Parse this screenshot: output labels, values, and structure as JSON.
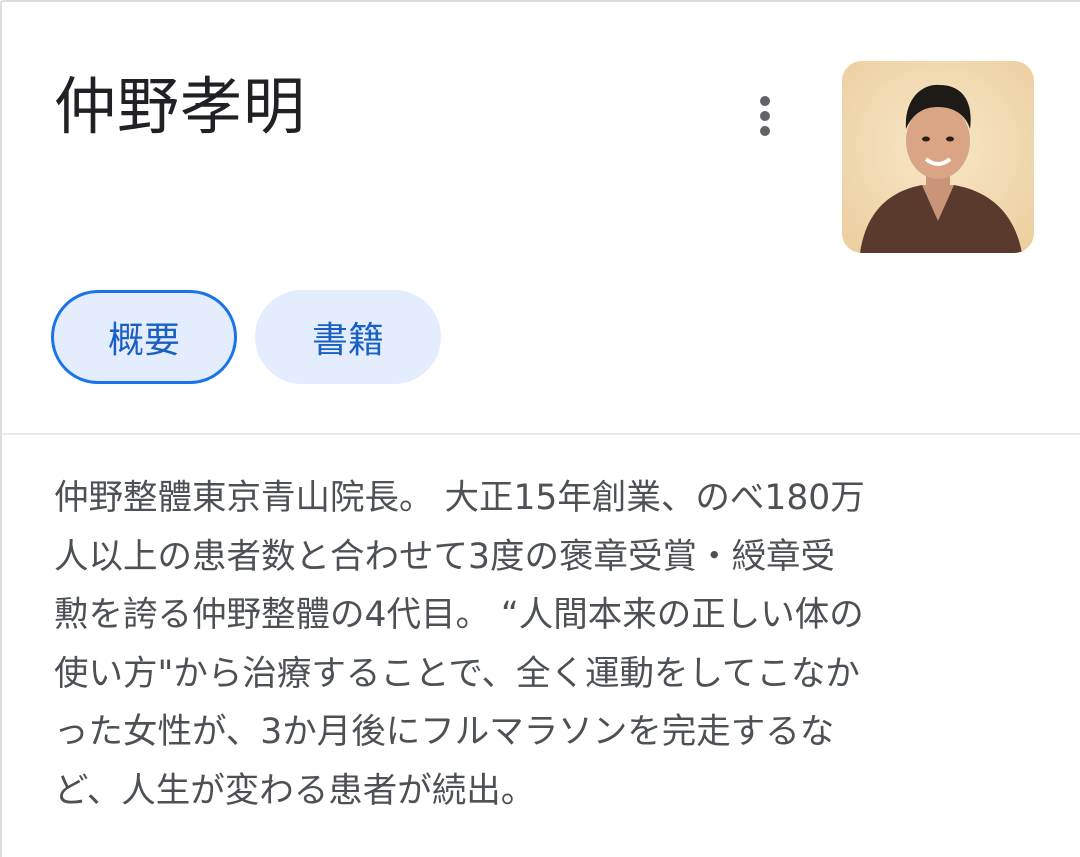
{
  "header": {
    "name": "仲野孝明"
  },
  "tabs": [
    {
      "label": "概要",
      "selected": true
    },
    {
      "label": "書籍",
      "selected": false
    }
  ],
  "description": {
    "lines": [
      "仲野整體東京青山院長。 大正15年創業、のべ180万",
      "人以上の患者数と合わせて3度の褒章受賞・綬章受",
      "勲を誇る仲野整體の4代目。 “人間本来の正しい体の",
      "使い方\"から治療することで、全く運動をしてこなか",
      "った女性が、3か月後にフルマラソンを完走するな",
      "ど、人生が変わる患者が続出。"
    ]
  },
  "colors": {
    "accent": "#1a73e8",
    "chip_background": "#e3edfd",
    "chip_text": "#1a5fc4",
    "title_text": "#202124",
    "body_text": "#4d5156"
  },
  "icons": {
    "more": "more-vert-icon"
  }
}
